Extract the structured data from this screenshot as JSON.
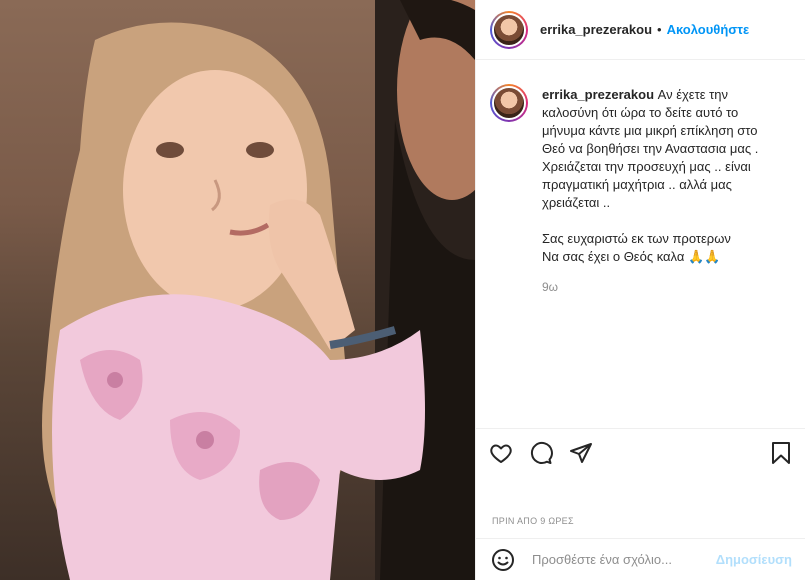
{
  "header": {
    "username": "errika_prezerakou",
    "dot": "•",
    "follow_label": "Ακολουθήστε"
  },
  "caption": {
    "username": "errika_prezerakou",
    "text": "Αν έχετε την καλοσύνη ότι ώρα το δείτε αυτό το μήνυμα κάντε μια μικρή επίκληση στο Θεό να βοηθήσει την Αναστασια μας . Χρειάζεται την προσευχή μας .. είναι πραγματική μαχήτρια .. αλλά μας χρειάζεται ..\n\nΣας ευχαριστώ εκ των προτερων\nΝα σας έχει ο Θεός καλα 🙏🙏",
    "age": "9ω"
  },
  "actions": {
    "like_icon": "heart-icon",
    "comment_icon": "comment-icon",
    "share_icon": "share-icon",
    "save_icon": "bookmark-icon"
  },
  "timestamp": "ΠΡΙΝ ΑΠΟ 9 ΩΡΕΣ",
  "comment_box": {
    "placeholder": "Προσθέστε ένα σχόλιο...",
    "post_label": "Δημοσίευση",
    "emoji_icon": "smiley-icon"
  },
  "colors": {
    "link_blue": "#0095f6",
    "post_disabled": "#b2dffc",
    "muted": "#8e8e8e"
  }
}
